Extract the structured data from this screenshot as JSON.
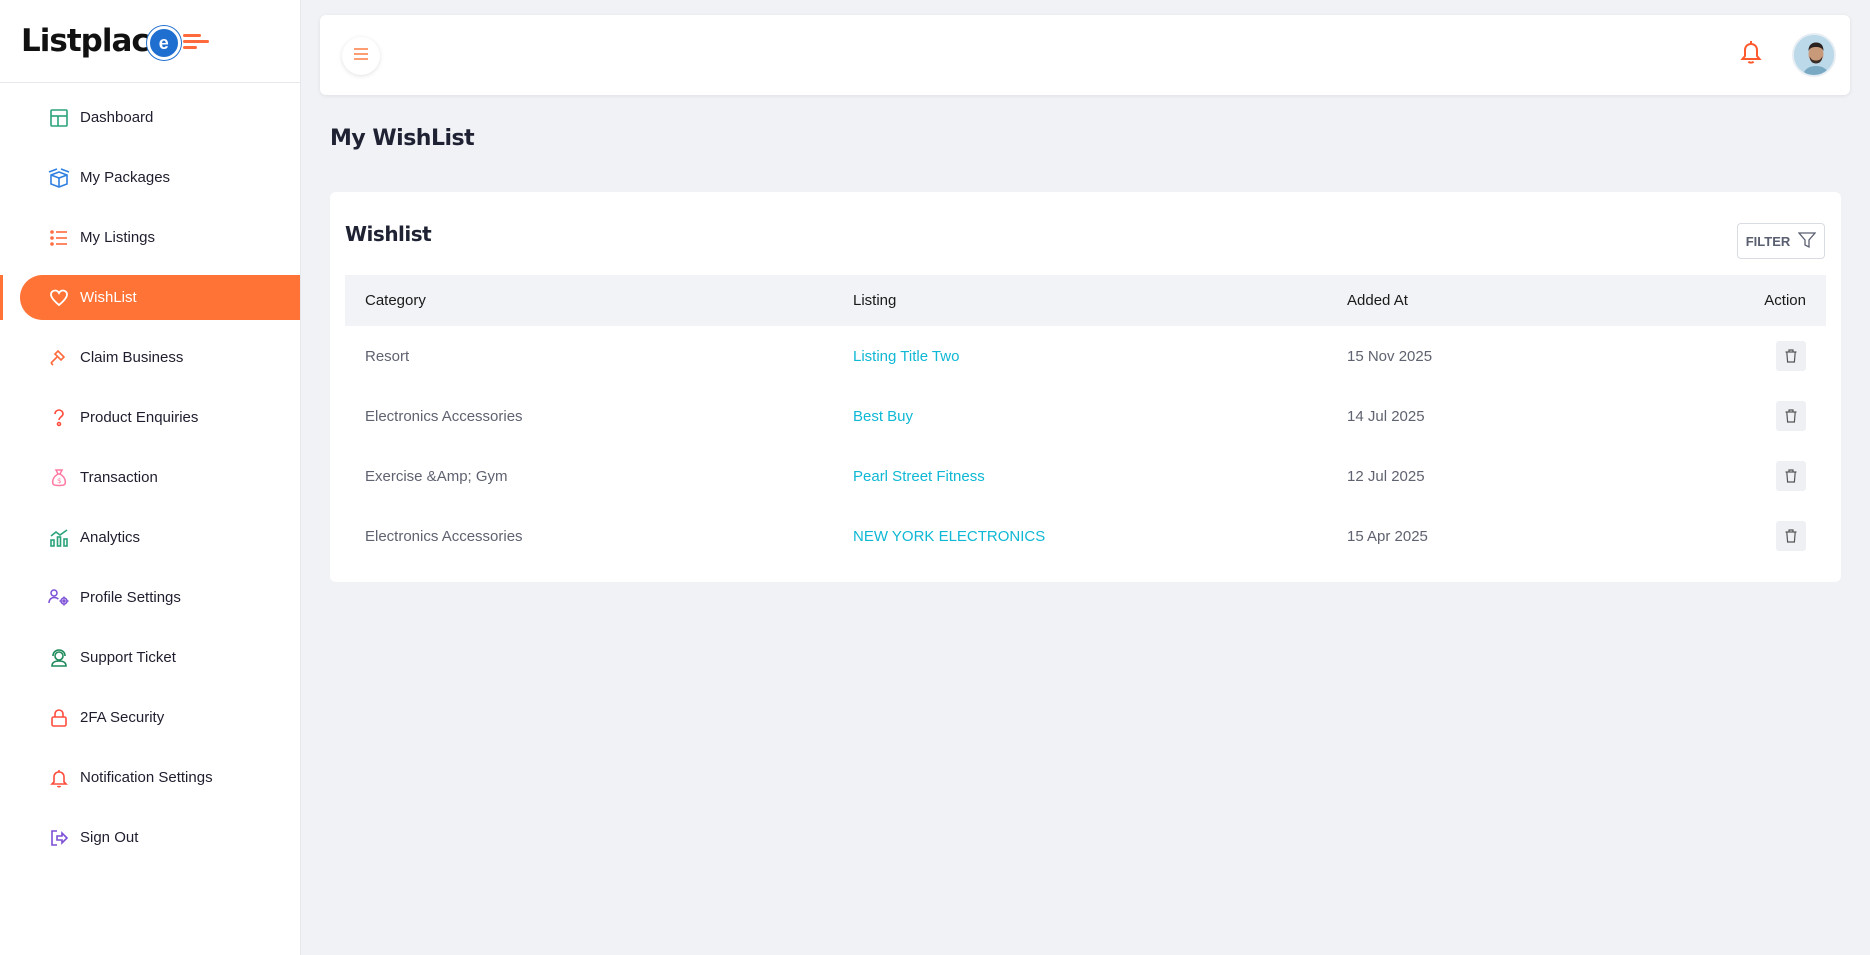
{
  "brand": {
    "name_prefix": "Listplac",
    "name_badge": "e"
  },
  "sidebar": {
    "items": [
      {
        "label": "Dashboard",
        "icon": "dashboard-icon",
        "color": "#2aa37a"
      },
      {
        "label": "My Packages",
        "icon": "box-icon",
        "color": "#2f7fe0"
      },
      {
        "label": "My Listings",
        "icon": "list-icon",
        "color": "#ff6a3d"
      },
      {
        "label": "WishList",
        "icon": "heart-icon",
        "color": "#ffffff",
        "active": true
      },
      {
        "label": "Claim Business",
        "icon": "hammer-icon",
        "color": "#ff6a3d"
      },
      {
        "label": "Product Enquiries",
        "icon": "question-icon",
        "color": "#ff4d3d"
      },
      {
        "label": "Transaction",
        "icon": "money-bag-icon",
        "color": "#ff7aa2"
      },
      {
        "label": "Analytics",
        "icon": "analytics-icon",
        "color": "#2aa37a"
      },
      {
        "label": "Profile Settings",
        "icon": "profile-gear-icon",
        "color": "#7b4fd6"
      },
      {
        "label": "Support Ticket",
        "icon": "support-icon",
        "color": "#1f8a5b"
      },
      {
        "label": "2FA Security",
        "icon": "lock-icon",
        "color": "#ff4d3d"
      },
      {
        "label": "Notification Settings",
        "icon": "bell-icon",
        "color": "#ff4d3d"
      },
      {
        "label": "Sign Out",
        "icon": "sign-out-icon",
        "color": "#7b4fd6"
      }
    ]
  },
  "header": {
    "menu_icon": "hamburger-icon",
    "bell_icon": "bell-icon",
    "accent": "#ff7336"
  },
  "page": {
    "title": "My WishList"
  },
  "wishlist": {
    "title": "Wishlist",
    "filter_label": "FILTER",
    "columns": [
      "Category",
      "Listing",
      "Added At",
      "Action"
    ],
    "rows": [
      {
        "category": "Resort",
        "listing": "Listing Title Two",
        "added_at": "15 Nov 2025"
      },
      {
        "category": "Electronics Accessories",
        "listing": "Best Buy",
        "added_at": "14 Jul 2025"
      },
      {
        "category": "Exercise &Amp; Gym",
        "listing": "Pearl Street Fitness",
        "added_at": "12 Jul 2025"
      },
      {
        "category": "Electronics Accessories",
        "listing": "NEW YORK ELECTRONICS",
        "added_at": "15 Apr 2025"
      }
    ]
  }
}
